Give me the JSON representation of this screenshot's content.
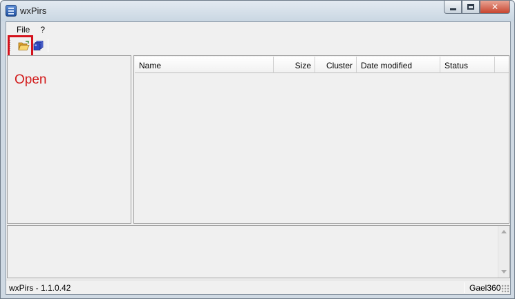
{
  "window": {
    "title": "wxPirs",
    "controls": {
      "minimize_icon": "minimize-icon",
      "maximize_icon": "maximize-icon",
      "close_label": "✕"
    }
  },
  "menu": {
    "items": [
      "File",
      "?"
    ]
  },
  "toolbar": {
    "buttons": [
      {
        "name": "open",
        "icon": "folder-open-icon"
      },
      {
        "name": "database",
        "icon": "database-icon"
      }
    ],
    "highlight_color": "#d4121c"
  },
  "left_pane": {
    "annotation": "Open",
    "annotation_color": "#d21b1b"
  },
  "file_list": {
    "columns": [
      "Name",
      "Size",
      "Cluster",
      "Date modified",
      "Status"
    ],
    "rows": []
  },
  "log_pane": {
    "text": ""
  },
  "status_bar": {
    "left": "wxPirs - 1.1.0.42",
    "right": "Gael360"
  }
}
